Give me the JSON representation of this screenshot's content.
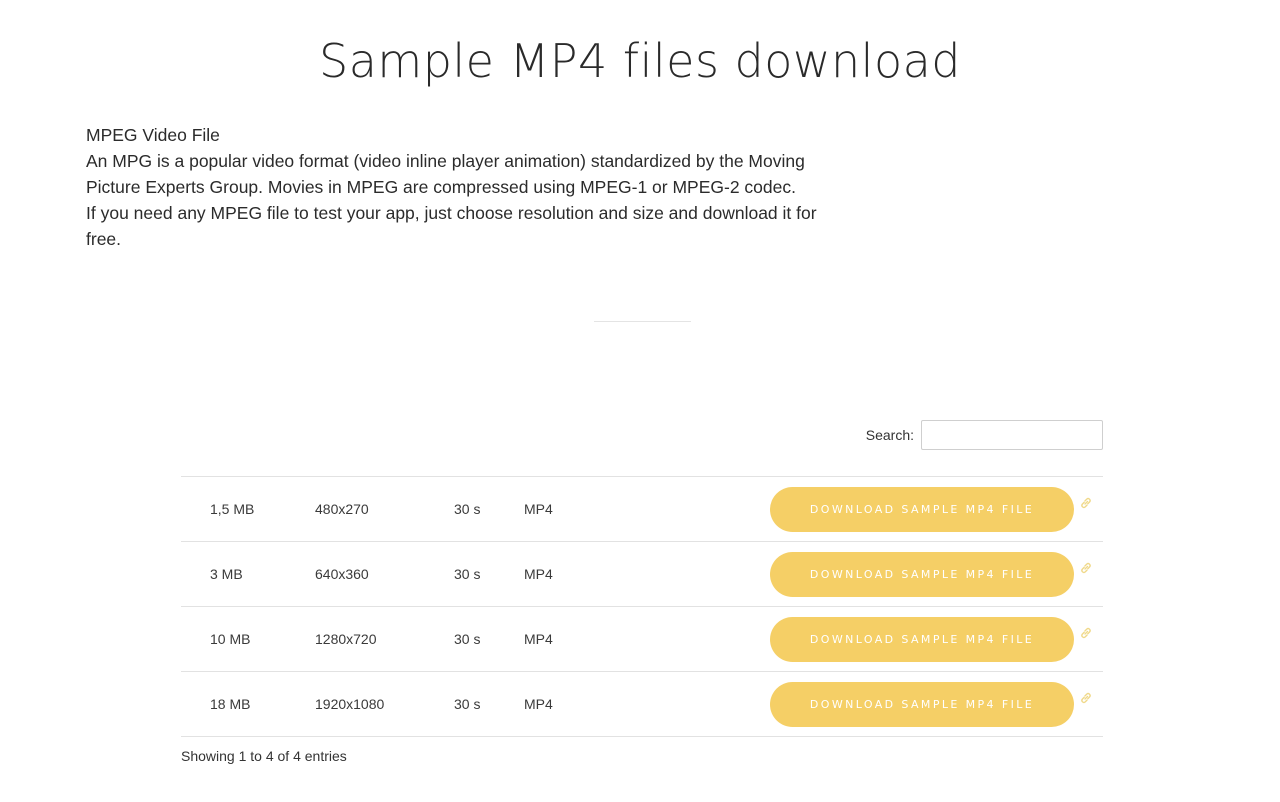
{
  "header": {
    "title": "Sample MP4 files download"
  },
  "intro": {
    "lines": [
      "MPEG Video File",
      "An MPG is a popular video format (video inline player animation) standardized by the Moving Picture Experts Group. Movies in MPEG are compressed using MPEG-1 or MPEG-2 codec.",
      "If you need any MPEG file to test your app, just choose resolution and size and download it for free."
    ]
  },
  "search": {
    "label": "Search:",
    "value": ""
  },
  "table": {
    "rows": [
      {
        "size": "1,5 MB",
        "resolution": "480x270",
        "duration": "30 s",
        "format": "MP4",
        "button": "DOWNLOAD SAMPLE MP4 FILE"
      },
      {
        "size": "3 MB",
        "resolution": "640x360",
        "duration": "30 s",
        "format": "MP4",
        "button": "DOWNLOAD SAMPLE MP4 FILE"
      },
      {
        "size": "10 MB",
        "resolution": "1280x720",
        "duration": "30 s",
        "format": "MP4",
        "button": "DOWNLOAD SAMPLE MP4 FILE"
      },
      {
        "size": "18 MB",
        "resolution": "1920x1080",
        "duration": "30 s",
        "format": "MP4",
        "button": "DOWNLOAD SAMPLE MP4 FILE"
      }
    ]
  },
  "footer": {
    "info": "Showing 1 to 4 of 4 entries"
  },
  "colors": {
    "button": "#f5cf66",
    "link_icon": "#f0d98a"
  },
  "icons": {
    "row_link": "link-icon"
  }
}
